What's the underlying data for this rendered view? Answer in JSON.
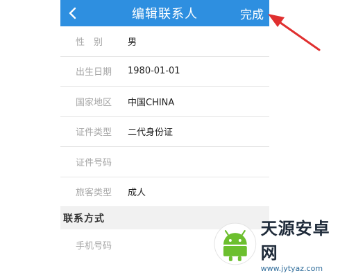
{
  "header": {
    "title": "编辑联系人",
    "done_label": "完成",
    "back_icon": "chevron-left-icon",
    "background": "#2e8fe0"
  },
  "form": {
    "rows": [
      {
        "label": "性　别",
        "value": "男"
      },
      {
        "label": "出生日期",
        "value": "1980-01-01"
      },
      {
        "label": "国家地区",
        "value": "中国CHINA"
      },
      {
        "label": "证件类型",
        "value": "二代身份证"
      },
      {
        "label": "证件号码",
        "value": ""
      },
      {
        "label": "旅客类型",
        "value": "成人"
      }
    ]
  },
  "contact_section": {
    "title": "联系方式",
    "phone_label": "手机号码"
  },
  "annotation": {
    "arrow_color": "#e02f2f",
    "icon": "red-arrow-icon"
  },
  "watermark": {
    "title": "天源安卓网",
    "url": "www.jytyaz.com",
    "logo_icon": "android-logo-icon",
    "logo_color": "#6cbf2e"
  }
}
